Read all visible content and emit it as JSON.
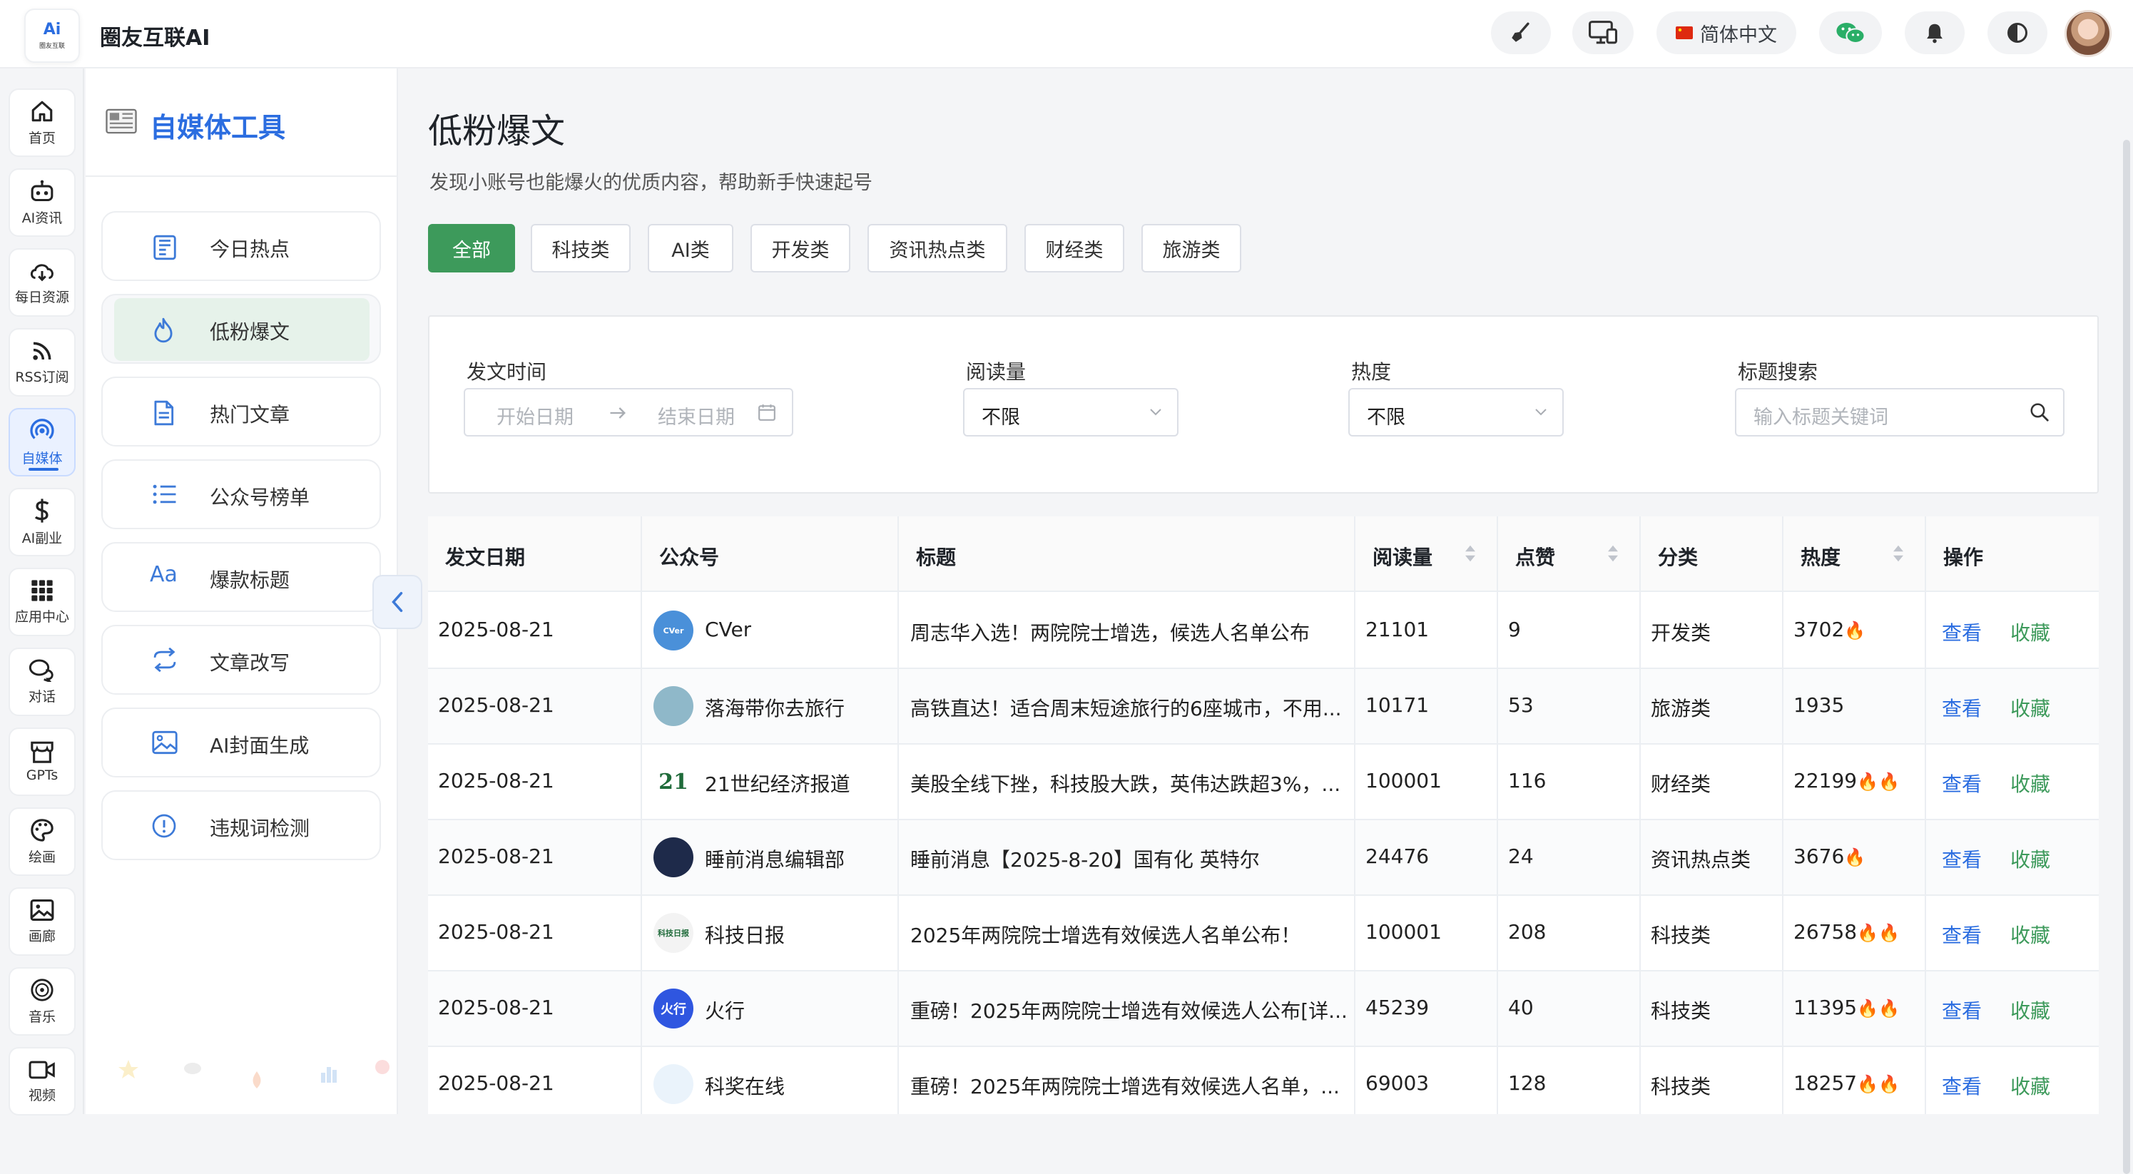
{
  "app": {
    "title": "圈友互联AI",
    "logo_text": "Ai",
    "logo_caption": "圈友互联"
  },
  "topbar": {
    "language": "简体中文",
    "icons": [
      "broom-icon",
      "monitor-icon",
      "flag-icon",
      "wechat-icon",
      "bell-icon",
      "contrast-icon"
    ]
  },
  "rail": {
    "items": [
      {
        "label": "首页",
        "icon": "home-icon"
      },
      {
        "label": "AI资讯",
        "icon": "robot-icon"
      },
      {
        "label": "每日资源",
        "icon": "cloud-download-icon"
      },
      {
        "label": "RSS订阅",
        "icon": "rss-icon"
      },
      {
        "label": "自媒体",
        "icon": "broadcast-icon"
      },
      {
        "label": "AI副业",
        "icon": "dollar-icon"
      },
      {
        "label": "应用中心",
        "icon": "grid-icon"
      },
      {
        "label": "对话",
        "icon": "chat-icon"
      },
      {
        "label": "GPTs",
        "icon": "store-icon"
      },
      {
        "label": "绘画",
        "icon": "palette-icon"
      },
      {
        "label": "画廊",
        "icon": "image-icon"
      },
      {
        "label": "音乐",
        "icon": "music-icon"
      },
      {
        "label": "视频",
        "icon": "video-icon"
      }
    ]
  },
  "subsidebar": {
    "title": "自媒体工具",
    "items": [
      {
        "label": "今日热点",
        "icon": "newspaper-icon"
      },
      {
        "label": "低粉爆文",
        "icon": "flame-icon"
      },
      {
        "label": "热门文章",
        "icon": "document-icon"
      },
      {
        "label": "公众号榜单",
        "icon": "list-icon"
      },
      {
        "label": "爆款标题",
        "icon": "font-icon"
      },
      {
        "label": "文章改写",
        "icon": "swap-icon"
      },
      {
        "label": "AI封面生成",
        "icon": "picture-icon"
      },
      {
        "label": "违规词检测",
        "icon": "alert-circle-icon"
      }
    ]
  },
  "page": {
    "title": "低粉爆文",
    "subtitle": "发现小账号也能爆火的优质内容，帮助新手快速起号",
    "tabs": [
      "全部",
      "科技类",
      "AI类",
      "开发类",
      "资讯热点类",
      "财经类",
      "旅游类"
    ]
  },
  "filters": {
    "date_label": "发文时间",
    "date_start_placeholder": "开始日期",
    "date_end_placeholder": "结束日期",
    "reads_label": "阅读量",
    "reads_value": "不限",
    "heat_label": "热度",
    "heat_value": "不限",
    "search_label": "标题搜索",
    "search_placeholder": "输入标题关键词"
  },
  "table": {
    "headers": [
      "发文日期",
      "公众号",
      "标题",
      "阅读量",
      "点赞",
      "分类",
      "热度",
      "操作"
    ],
    "action_view": "查看",
    "action_fav": "收藏",
    "rows": [
      {
        "date": "2025-08-21",
        "account": "CVer",
        "avatar_text": "CVer",
        "avatar_bg": "#4a90d9",
        "title": "周志华入选！两院院士增选，候选人名单公布",
        "reads": "21101",
        "likes": "9",
        "category": "开发类",
        "heat": "3702",
        "fires": "🔥"
      },
      {
        "date": "2025-08-21",
        "account": "落海带你去旅行",
        "avatar_text": "",
        "avatar_bg": "#8fb8c9",
        "title": "高铁直达！适合周末短途旅行的6座城市，不用...",
        "reads": "10171",
        "likes": "53",
        "category": "旅游类",
        "heat": "1935",
        "fires": ""
      },
      {
        "date": "2025-08-21",
        "account": "21世纪经济报道",
        "avatar_text": "21",
        "avatar_bg": "#ffffff",
        "title": "美股全线下挫，科技股大跌，英伟达跌超3%，...",
        "reads": "100001",
        "likes": "116",
        "category": "财经类",
        "heat": "22199",
        "fires": "🔥🔥"
      },
      {
        "date": "2025-08-21",
        "account": "睡前消息编辑部",
        "avatar_text": "",
        "avatar_bg": "#1e2a4a",
        "title": "睡前消息【2025-8-20】国有化 英特尔",
        "reads": "24476",
        "likes": "24",
        "category": "资讯热点类",
        "heat": "3676",
        "fires": "🔥"
      },
      {
        "date": "2025-08-21",
        "account": "科技日报",
        "avatar_text": "科技日报",
        "avatar_bg": "#f3f3f3",
        "title": "2025年两院院士增选有效候选人名单公布！",
        "reads": "100001",
        "likes": "208",
        "category": "科技类",
        "heat": "26758",
        "fires": "🔥🔥"
      },
      {
        "date": "2025-08-21",
        "account": "火行",
        "avatar_text": "火行",
        "avatar_bg": "#2f56e0",
        "title": "重磅！2025年两院院士增选有效候选人公布[详...",
        "reads": "45239",
        "likes": "40",
        "category": "科技类",
        "heat": "11395",
        "fires": "🔥🔥"
      },
      {
        "date": "2025-08-21",
        "account": "科奖在线",
        "avatar_text": "",
        "avatar_bg": "#eaf3fb",
        "title": "重磅！2025年两院院士增选有效候选人名单，...",
        "reads": "69003",
        "likes": "128",
        "category": "科技类",
        "heat": "18257",
        "fires": "🔥🔥"
      }
    ]
  }
}
